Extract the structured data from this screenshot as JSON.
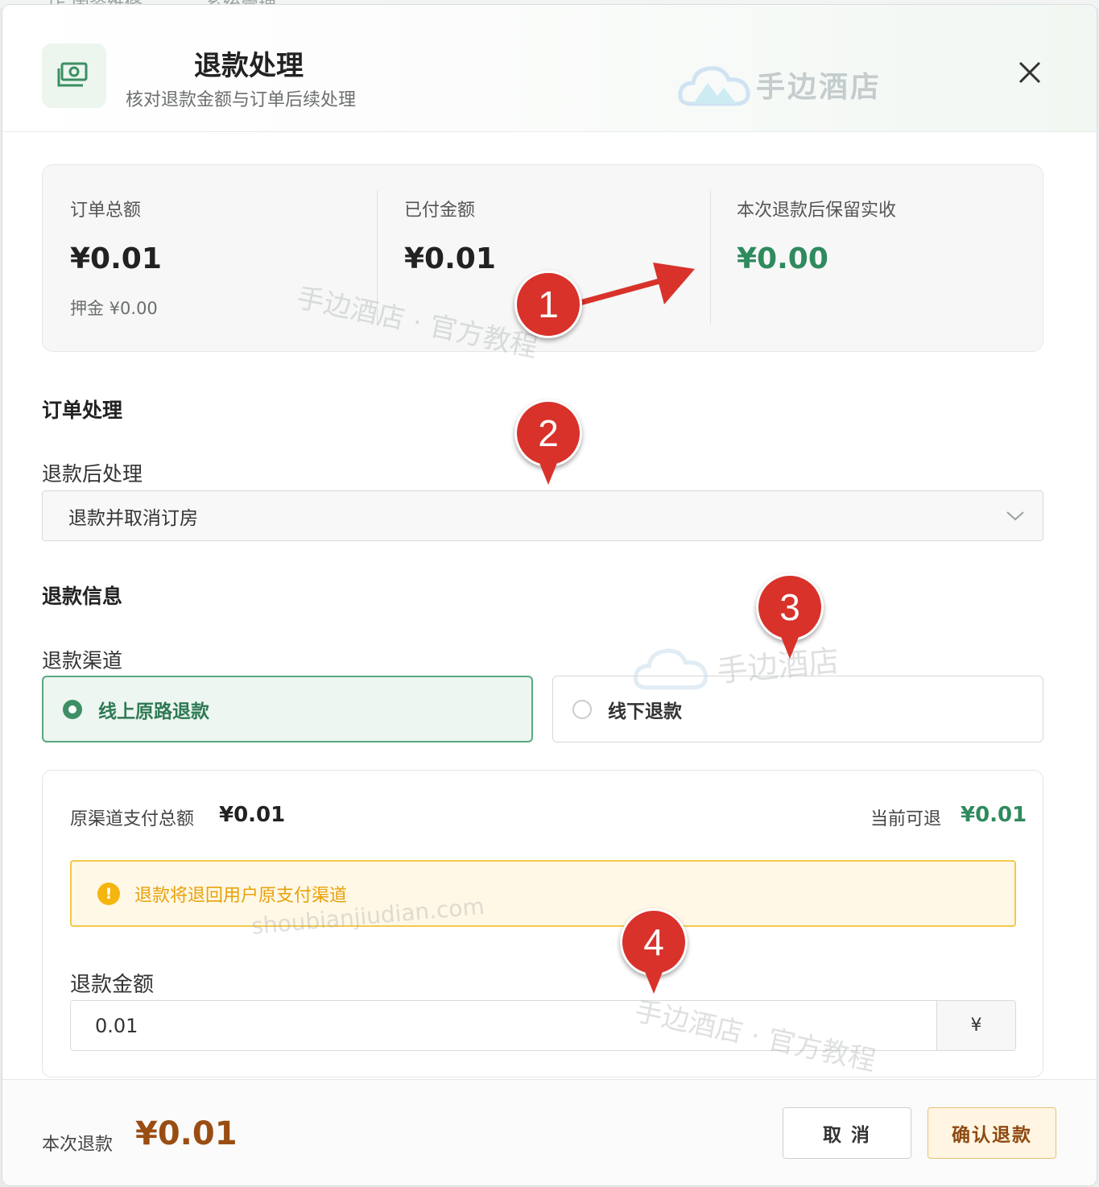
{
  "backdrop": {
    "left_text": "店 固资维修",
    "mid_text": "系统管理"
  },
  "header": {
    "title": "退款处理",
    "subtitle": "核对退款金额与订单后续处理",
    "logo_text": "手边酒店"
  },
  "summary": {
    "order_total_label": "订单总额",
    "order_total_value": "¥0.01",
    "deposit_text": "押金 ¥0.00",
    "paid_label": "已付金额",
    "paid_value": "¥0.01",
    "retained_label": "本次退款后保留实收",
    "retained_value": "¥0.00"
  },
  "order_section": {
    "title": "订单处理",
    "after_label": "退款后处理",
    "after_selected": "退款并取消订房"
  },
  "refund_section": {
    "title": "退款信息",
    "channel_label": "退款渠道",
    "channels": [
      {
        "label": "线上原路退款",
        "selected": true
      },
      {
        "label": "线下退款",
        "selected": false
      }
    ]
  },
  "detail": {
    "orig_label": "原渠道支付总额",
    "orig_value": "¥0.01",
    "available_label": "当前可退",
    "available_value": "¥0.01",
    "notice": "退款将退回用户原支付渠道",
    "amount_label": "退款金额",
    "amount_value": "0.01",
    "amount_unit": "¥"
  },
  "footer": {
    "this_refund_label": "本次退款",
    "this_refund_value": "¥0.01",
    "cancel_label": "取 消",
    "confirm_label": "确认退款"
  },
  "watermarks": {
    "tutorial": "手边酒店 · 官方教程",
    "logo": "手边酒店",
    "domain": "shoubianjiudian.com"
  },
  "badges": [
    "1",
    "2",
    "3",
    "4"
  ],
  "colors": {
    "accent_green": "#2f8a5e",
    "warning": "#f3c94b",
    "refund_brown": "#9a4d13",
    "badge_red": "#d8322b"
  }
}
